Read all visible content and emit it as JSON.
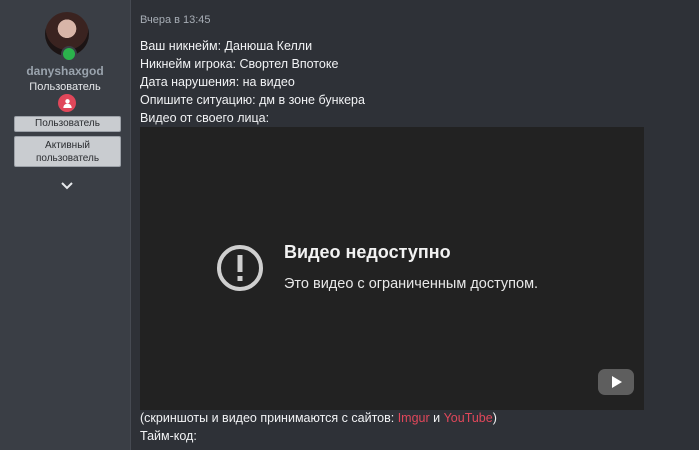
{
  "user": {
    "username": "danyshaxgod",
    "title": "Пользователь",
    "badges": [
      "Пользователь",
      "Активный",
      "пользователь"
    ]
  },
  "post": {
    "timestamp": "Вчера в 13:45",
    "lines": [
      "Ваш никнейм: Данюша Келли",
      "Никнейм игрока: Свортел Впотоке",
      "Дата нарушения: на видео",
      "Опишите ситуацию: дм в зоне бункера",
      "Видео от своего лица:"
    ],
    "video": {
      "title": "Видео недоступно",
      "subtitle": "Это видео с ограниченным доступом."
    },
    "footer": {
      "prefix": "(скриншоты и видео принимаются с сайтов: ",
      "link1": "Imgur",
      "and": " и ",
      "link2": "YouTube",
      "suffix": ")",
      "timecode": "Тайм-код:"
    }
  },
  "colors": {
    "accent": "#e0475a",
    "online": "#2bb24c",
    "username": "#9aa3ad"
  },
  "icons": [
    "online-status-icon",
    "role-icon",
    "chevron-down-icon",
    "warning-icon",
    "youtube-logo-icon"
  ]
}
